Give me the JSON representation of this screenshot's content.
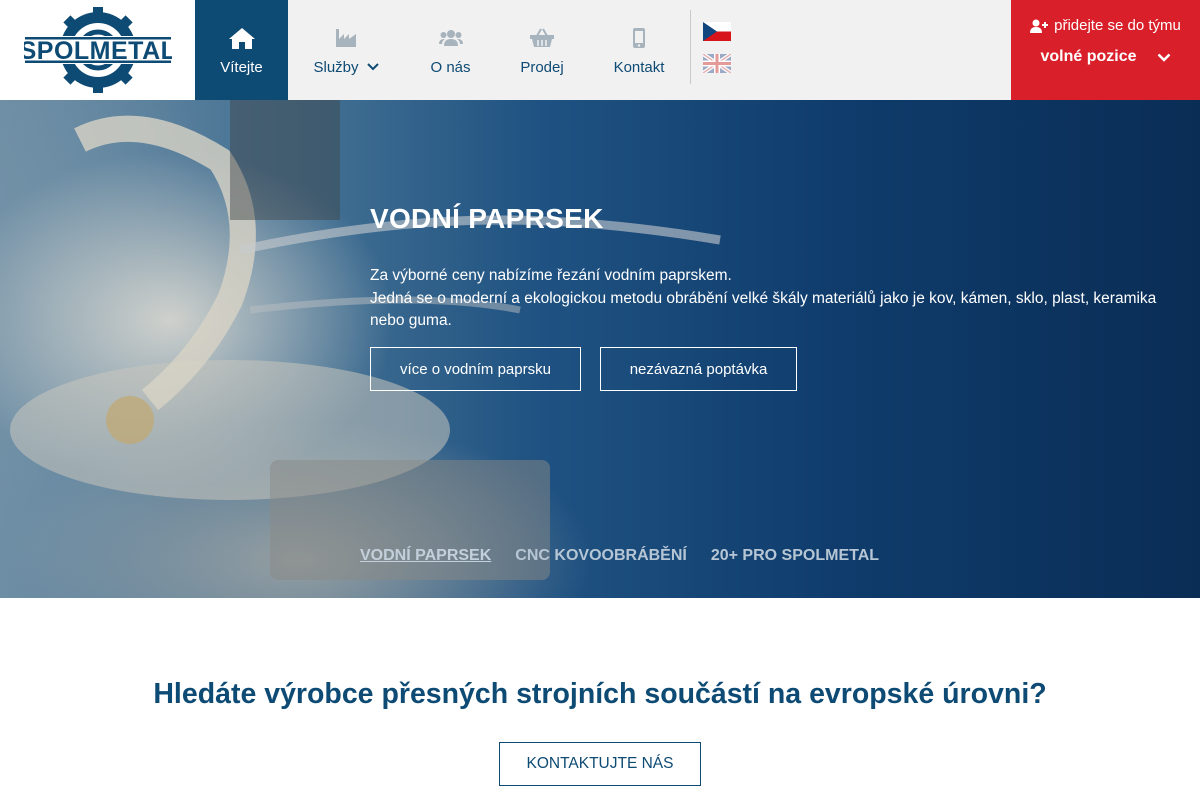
{
  "brand": {
    "logo_text": "SPOLMETAL",
    "primary_color": "#0d4a74",
    "accent_color": "#d9202a"
  },
  "nav": {
    "items": [
      {
        "label": "Vítejte",
        "icon": "home-icon",
        "active": true
      },
      {
        "label": "Služby",
        "icon": "factory-icon",
        "has_dropdown": true
      },
      {
        "label": "O nás",
        "icon": "users-icon"
      },
      {
        "label": "Prodej",
        "icon": "basket-icon"
      },
      {
        "label": "Kontakt",
        "icon": "mobile-icon"
      }
    ]
  },
  "languages": [
    {
      "icon": "czech-flag-icon"
    },
    {
      "icon": "uk-flag-icon"
    }
  ],
  "team": {
    "top_label": "přidejte se do týmu",
    "bottom_label": "volné pozice"
  },
  "hero": {
    "title": "VODNÍ PAPRSEK",
    "text_line1": "Za výborné ceny nabízíme řezání vodním paprskem.",
    "text_line2": "Jedná se o moderní a ekologickou metodu obrábění velké škály materiálů jako je kov, kámen, sklo, plast, keramika nebo guma.",
    "button_more": "více o vodním paprsku",
    "button_inquiry": "nezávazná poptávka",
    "slides": [
      "VODNÍ PAPRSEK",
      "CNC KOVOOBRÁBĚNÍ",
      "20+ PRO SPOLMETAL"
    ]
  },
  "cta": {
    "title": "Hledáte výrobce přesných strojních součástí na evropské úrovni?",
    "button": "KONTAKTUJTE NÁS"
  }
}
